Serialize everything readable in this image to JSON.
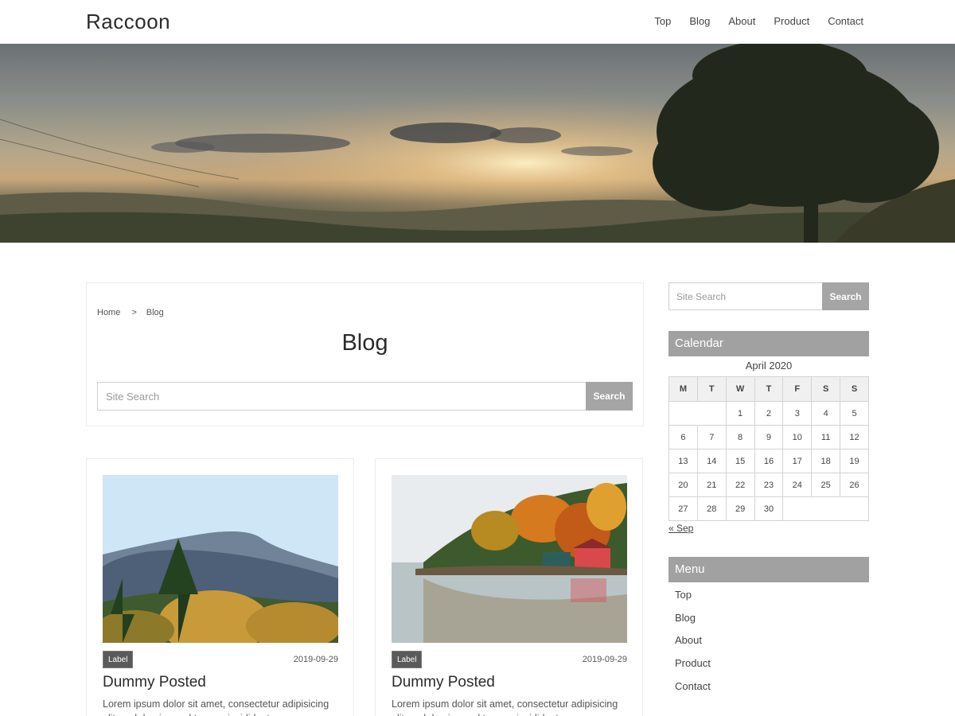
{
  "header": {
    "logo": "Raccoon",
    "nav": [
      "Top",
      "Blog",
      "About",
      "Product",
      "Contact"
    ]
  },
  "breadcrumb": {
    "home": "Home",
    "separator": ">",
    "current": "Blog"
  },
  "page": {
    "title": "Blog"
  },
  "main_search": {
    "placeholder": "Site Search",
    "button": "Search"
  },
  "posts": [
    {
      "label": "Label",
      "date": "2019-09-29",
      "title": "Dummy Posted",
      "excerpt": "Lorem ipsum dolor sit amet, consectetur adipisicing elit, sed do eiusmod tempor incididunt"
    },
    {
      "label": "Label",
      "date": "2019-09-29",
      "title": "Dummy Posted",
      "excerpt": "Lorem ipsum dolor sit amet, consectetur adipisicing elit, sed do eiusmod tempor incididunt"
    }
  ],
  "sidebar": {
    "search": {
      "placeholder": "Site Search",
      "button": "Search"
    },
    "calendar": {
      "title": "Calendar",
      "caption": "April 2020",
      "weekdays": [
        "M",
        "T",
        "W",
        "T",
        "F",
        "S",
        "S"
      ],
      "rows": [
        [
          "",
          "",
          "1",
          "2",
          "3",
          "4",
          "5"
        ],
        [
          "6",
          "7",
          "8",
          "9",
          "10",
          "11",
          "12"
        ],
        [
          "13",
          "14",
          "15",
          "16",
          "17",
          "18",
          "19"
        ],
        [
          "20",
          "21",
          "22",
          "23",
          "24",
          "25",
          "26"
        ],
        [
          "27",
          "28",
          "29",
          "30",
          "",
          "",
          ""
        ]
      ],
      "prev": "« Sep"
    },
    "menu": {
      "title": "Menu",
      "items": [
        "Top",
        "Blog",
        "About",
        "Product",
        "Contact"
      ]
    }
  },
  "colors": {
    "widget_header": "#a1a1a1",
    "search_button": "#a5a5a5",
    "label_bg": "#5a5a5a"
  }
}
